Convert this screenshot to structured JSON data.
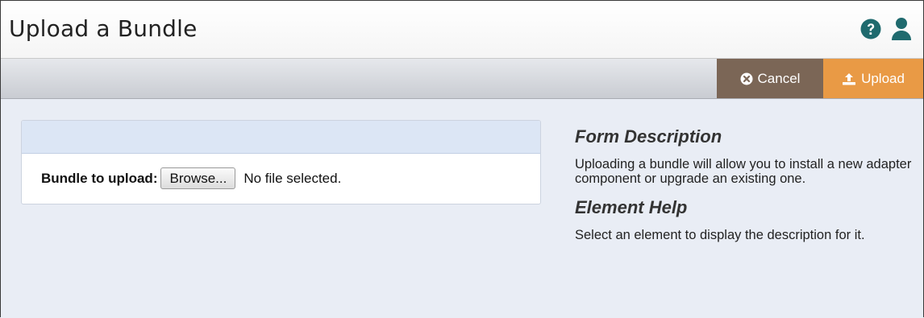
{
  "header": {
    "title": "Upload a Bundle",
    "help_icon": "question-circle-icon",
    "user_icon": "user-icon"
  },
  "toolbar": {
    "cancel_label": "Cancel",
    "cancel_icon": "times-circle-icon",
    "upload_label": "Upload",
    "upload_icon": "upload-icon",
    "colors": {
      "cancel": "#7b6656",
      "upload": "#e99a45"
    }
  },
  "form": {
    "field_label": "Bundle to upload:",
    "browse_label": "Browse...",
    "file_status": "No file selected."
  },
  "help": {
    "form_description_heading": "Form Description",
    "form_description_text": "Uploading a bundle will allow you to install a new adapter component or upgrade an existing one.",
    "element_help_heading": "Element Help",
    "element_help_text": "Select an element to display the description for it."
  }
}
